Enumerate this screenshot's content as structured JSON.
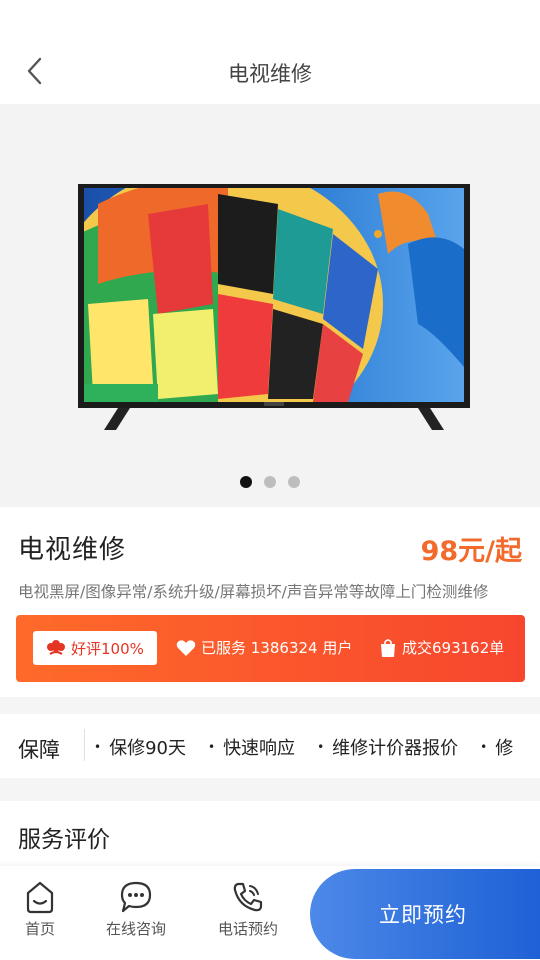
{
  "header": {
    "title": "电视维修"
  },
  "carousel": {
    "slides": 3,
    "active_index": 0
  },
  "product": {
    "name": "电视维修",
    "price": "98元/起",
    "description": "电视黑屏/图像异常/系统升级/屏幕损坏/声音异常等故障上门检测维修"
  },
  "stats": {
    "good_rating": "好评100%",
    "served": "已服务 1386324 用户",
    "deals": "成交693162单"
  },
  "guarantee": {
    "title": "保障",
    "items": [
      "保修90天",
      "快速响应",
      "维修计价器报价",
      "修"
    ]
  },
  "reviews": {
    "title": "服务评价"
  },
  "bottom_nav": {
    "home": "首页",
    "consult": "在线咨询",
    "phone": "电话预约",
    "book": "立即预约"
  },
  "colors": {
    "price": "#f26a2c",
    "stats_bg": "#f7462e",
    "cta": "#2e6fdc"
  }
}
